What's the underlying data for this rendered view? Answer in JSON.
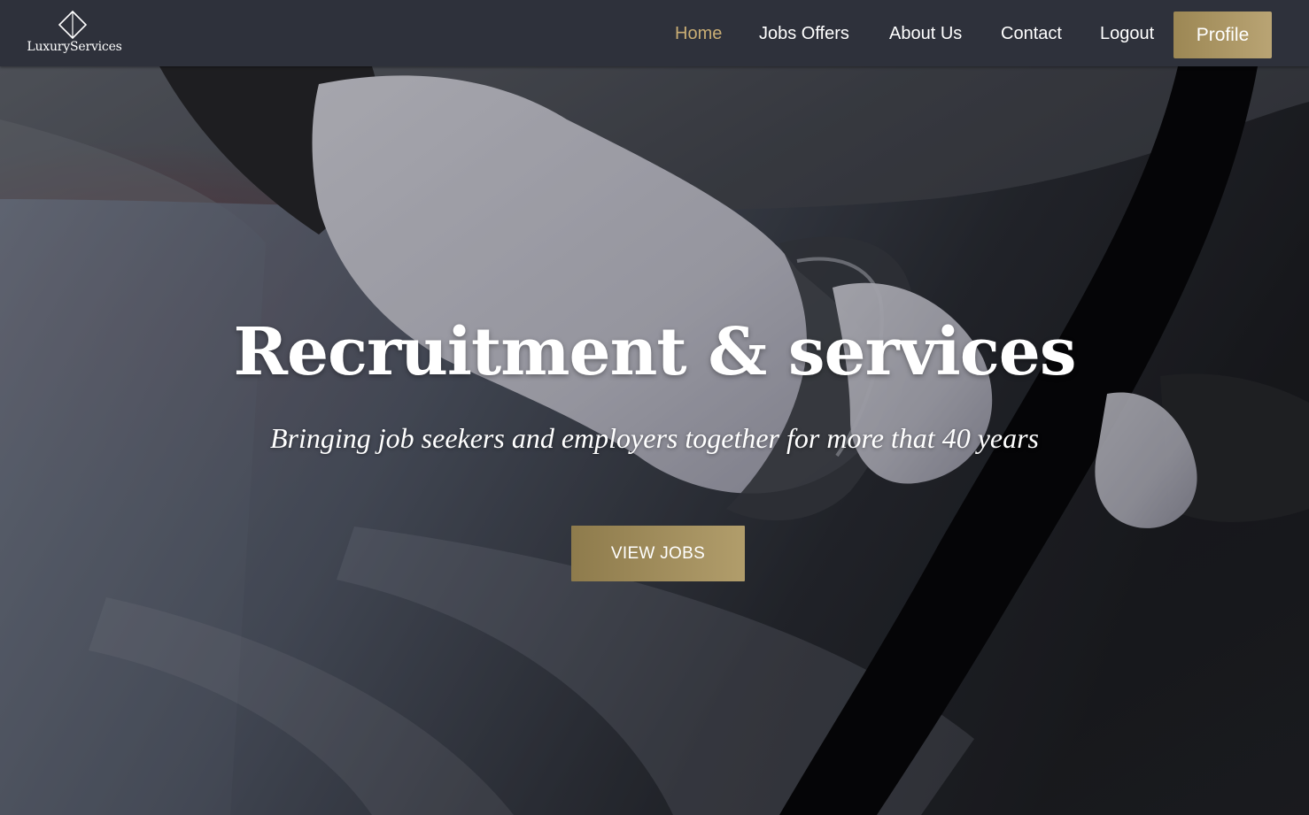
{
  "brand": {
    "name": "LuxuryServices",
    "logo_icon": "diamond-outline-icon"
  },
  "nav": {
    "items": [
      {
        "label": "Home",
        "active": true
      },
      {
        "label": "Jobs Offers",
        "active": false
      },
      {
        "label": "About Us",
        "active": false
      },
      {
        "label": "Contact",
        "active": false
      },
      {
        "label": "Logout",
        "active": false
      }
    ],
    "profile_label": "Profile"
  },
  "hero": {
    "title": "Recruitment & services",
    "subtitle": "Bringing job seekers and employers together for more that 40 years",
    "cta_label": "VIEW JOBS",
    "background_image": "white-gloved-hand-opening-black-car-door"
  },
  "colors": {
    "navbar_bg": "#2e313b",
    "accent_gold": "#c9ad74",
    "button_gold_start": "#9c8754",
    "button_gold_end": "#b9a474",
    "text_white": "#ffffff"
  }
}
